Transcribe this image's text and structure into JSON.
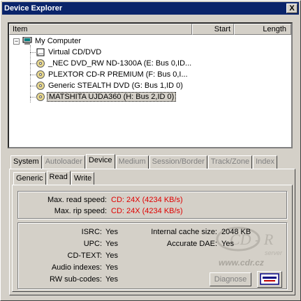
{
  "window": {
    "title": "Device Explorer",
    "close_label": "X"
  },
  "columns": {
    "item": "Item",
    "start": "Start",
    "length": "Length"
  },
  "tree": {
    "root": "My Computer",
    "devices": [
      {
        "label": "Virtual CD/DVD",
        "icon": "virtual-drive-icon"
      },
      {
        "label": "_NEC DVD_RW ND-1300A (E: Bus 0,ID...",
        "icon": "optical-drive-icon"
      },
      {
        "label": "PLEXTOR CD-R   PREMIUM (F: Bus 0,I...",
        "icon": "optical-drive-icon"
      },
      {
        "label": "Generic STEALTH DVD (G: Bus 1,ID 0)",
        "icon": "optical-drive-icon"
      },
      {
        "label": "MATSHITA UJDA360 (H: Bus 2,ID 0)",
        "icon": "optical-drive-icon"
      }
    ]
  },
  "tabs": [
    "System",
    "Autoloader",
    "Device",
    "Medium",
    "Session/Border",
    "Track/Zone",
    "Index"
  ],
  "subtabs": [
    "Generic",
    "Read",
    "Write"
  ],
  "read": {
    "max_read_label": "Max. read speed:",
    "max_read_value": "CD: 24X (4234 KB/s)",
    "max_rip_label": "Max. rip speed:",
    "max_rip_value": "CD: 24X (4234 KB/s)"
  },
  "caps": {
    "isrc_label": "ISRC:",
    "isrc": "Yes",
    "upc_label": "UPC:",
    "upc": "Yes",
    "cdtext_label": "CD-TEXT:",
    "cdtext": "Yes",
    "audio_label": "Audio indexes:",
    "audio": "Yes",
    "rw_label": "RW sub-codes:",
    "rw": "Yes",
    "cache_label": "Internal cache size:",
    "cache": "2048 KB",
    "dae_label": "Accurate DAE:",
    "dae": "Yes"
  },
  "buttons": {
    "diagnose": "Diagnose"
  },
  "watermark": {
    "brand": "CD - R",
    "sub": "server",
    "url": "www.cdr.cz"
  },
  "colors": {
    "title_bar": "#0a246a",
    "value_red": "#e00000",
    "face": "#d4d0c8"
  }
}
